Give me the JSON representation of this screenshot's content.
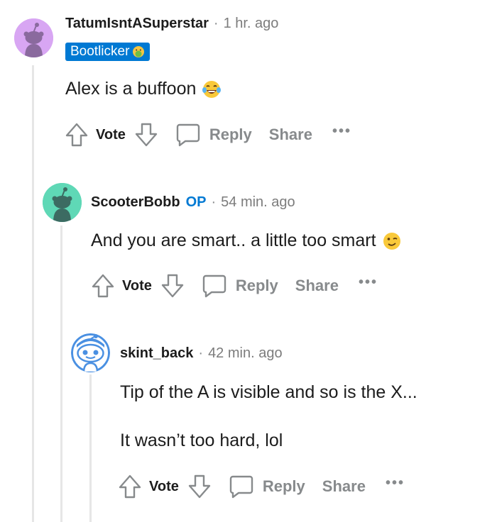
{
  "comments": [
    {
      "username": "TatumIsntASuperstar",
      "separator": "·",
      "time": "1 hr. ago",
      "flair": "Bootlicker",
      "flair_emoji": "nauseated-face-icon",
      "avatar_color": "#d7a9f0",
      "body": [
        "Alex is a buffoon"
      ],
      "body_emoji": "laughing-tears-icon",
      "actions": {
        "vote": "Vote",
        "reply": "Reply",
        "share": "Share",
        "more": "•••"
      }
    },
    {
      "username": "ScooterBobb",
      "op_badge": "OP",
      "separator": "·",
      "time": "54 min. ago",
      "avatar_color": "#4fd1b0",
      "body": [
        "And you are smart.. a little too smart"
      ],
      "body_emoji": "winking-face-icon",
      "actions": {
        "vote": "Vote",
        "reply": "Reply",
        "share": "Share",
        "more": "•••"
      }
    },
    {
      "username": "skint_back",
      "separator": "·",
      "time": "42 min. ago",
      "avatar_color": "#4a90e2",
      "body": [
        "Tip of the A is visible and so is the X...",
        "It wasn’t too hard, lol"
      ],
      "actions": {
        "vote": "Vote",
        "reply": "Reply",
        "share": "Share",
        "more": "•••"
      }
    }
  ],
  "colors": {
    "username": "#1c1c1c",
    "meta": "#7c7c7c",
    "action_gray": "#878a8c",
    "op_blue": "#0079d3",
    "flair_bg": "#0079d3",
    "thread_line": "#e6e6e6"
  }
}
